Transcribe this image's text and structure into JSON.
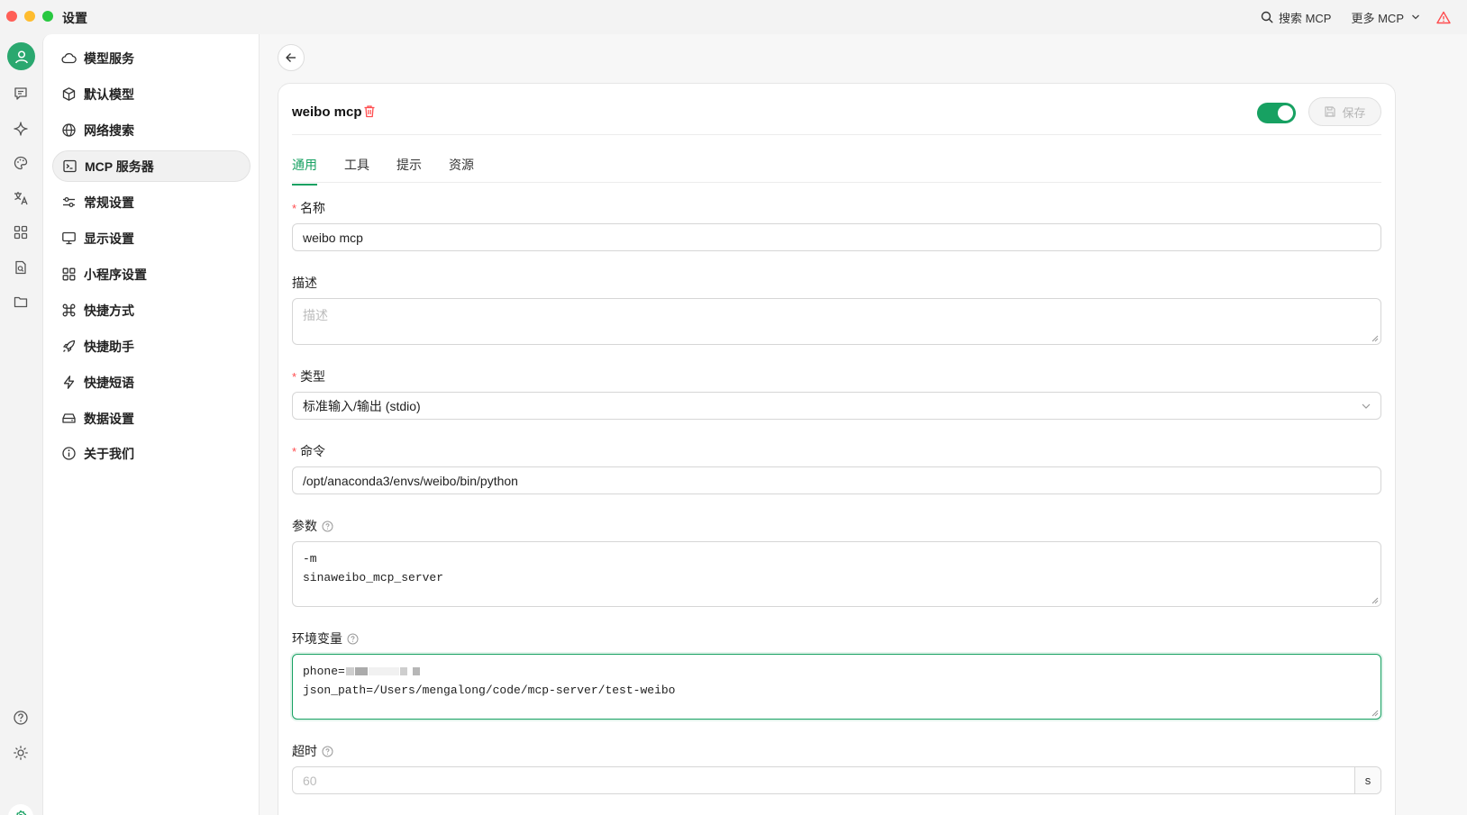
{
  "window": {
    "title": "设置"
  },
  "titlebar": {
    "search_mcp": "搜索 MCP",
    "more_mcp": "更多 MCP"
  },
  "rail": {
    "icons": [
      "user-avatar-icon",
      "chat-icon",
      "sparkle-icon",
      "palette-icon",
      "translate-icon",
      "apps-grid-icon",
      "file-search-icon",
      "folder-icon",
      "help-icon",
      "brightness-icon",
      "settings-icon"
    ]
  },
  "nav": {
    "items": [
      {
        "label": "模型服务",
        "icon": "cloud-icon"
      },
      {
        "label": "默认模型",
        "icon": "cube-icon"
      },
      {
        "label": "网络搜索",
        "icon": "globe-icon"
      },
      {
        "label": "MCP 服务器",
        "icon": "terminal-icon",
        "active": true
      },
      {
        "label": "常规设置",
        "icon": "sliders-icon"
      },
      {
        "label": "显示设置",
        "icon": "monitor-icon"
      },
      {
        "label": "小程序设置",
        "icon": "apps-grid-icon"
      },
      {
        "label": "快捷方式",
        "icon": "command-icon"
      },
      {
        "label": "快捷助手",
        "icon": "rocket-icon"
      },
      {
        "label": "快捷短语",
        "icon": "lightning-icon"
      },
      {
        "label": "数据设置",
        "icon": "storage-icon"
      },
      {
        "label": "关于我们",
        "icon": "info-icon"
      }
    ]
  },
  "server": {
    "name": "weibo mcp",
    "enabled": true,
    "save_label": "保存",
    "colors": {
      "accent": "#17a162",
      "danger": "#ff4d4f"
    }
  },
  "tabs": [
    "通用",
    "工具",
    "提示",
    "资源"
  ],
  "active_tab": "通用",
  "form": {
    "name": {
      "label": "名称",
      "value": "weibo mcp",
      "required": true
    },
    "description": {
      "label": "描述",
      "placeholder": "描述",
      "value": ""
    },
    "type": {
      "label": "类型",
      "value": "标准输入/输出 (stdio)",
      "required": true
    },
    "command": {
      "label": "命令",
      "value": "/opt/anaconda3/envs/weibo/bin/python",
      "required": true
    },
    "args": {
      "label": "参数",
      "line1": "-m",
      "line2": "sinaweibo_mcp_server"
    },
    "env": {
      "label": "环境变量",
      "line1_prefix": "phone=",
      "line2": "json_path=/Users/mengalong/code/mcp-server/test-weibo"
    },
    "timeout": {
      "label": "超时",
      "placeholder": "60",
      "suffix": "s"
    }
  }
}
